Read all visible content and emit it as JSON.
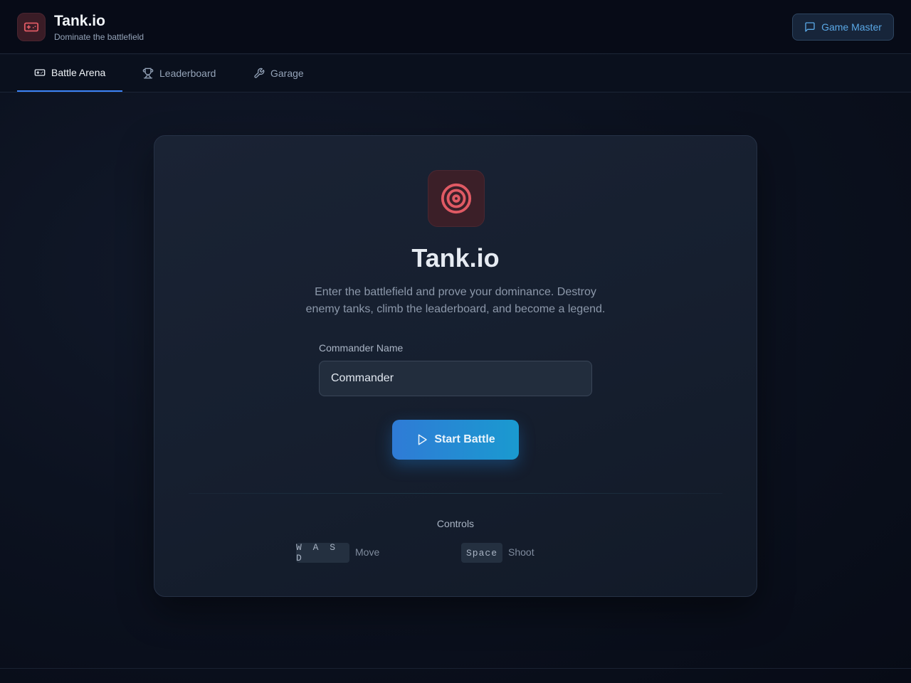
{
  "header": {
    "title": "Tank.io",
    "subtitle": "Dominate the battlefield",
    "logo_icon": "gamepad-icon",
    "game_master_label": "Game Master"
  },
  "tabs": [
    {
      "label": "Battle Arena",
      "icon": "gamepad-icon",
      "active": true
    },
    {
      "label": "Leaderboard",
      "icon": "trophy-icon",
      "active": false
    },
    {
      "label": "Garage",
      "icon": "wrench-icon",
      "active": false
    }
  ],
  "main": {
    "hero_icon": "target-icon",
    "title": "Tank.io",
    "description": "Enter the battlefield and prove your dominance. Destroy enemy tanks, climb the leaderboard, and become a legend.",
    "name_label": "Commander Name",
    "name_value": "Commander",
    "start_label": "Start Battle",
    "controls": {
      "title": "Controls",
      "items": [
        {
          "keys": "W A S D",
          "action": "Move"
        },
        {
          "keys": "Space",
          "action": "Shoot"
        }
      ]
    }
  },
  "colors": {
    "accent": "#3b82f6",
    "logo_red": "#e05a64",
    "button_start": "#2f7bd6",
    "button_end": "#1a9ad0"
  }
}
